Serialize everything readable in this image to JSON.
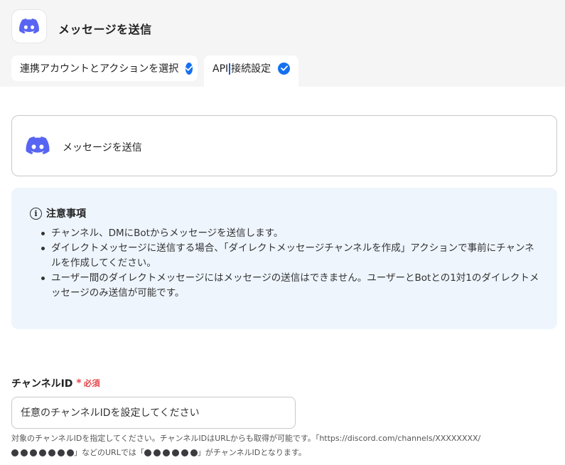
{
  "header": {
    "title": "メッセージを送信",
    "app_icon": "discord-icon"
  },
  "tabs": [
    {
      "label": "連携アカウントとアクションを選択",
      "completed": true
    },
    {
      "label_before_cursor": "API",
      "label_after_cursor": "接続設定",
      "completed": true,
      "active": true
    }
  ],
  "action_card": {
    "title": "メッセージを送信",
    "icon": "discord-icon"
  },
  "notice": {
    "title": "注意事項",
    "items": [
      "チャンネル、DMにBotからメッセージを送信します。",
      "ダイレクトメッセージに送信する場合、「ダイレクトメッセージチャンネルを作成」アクションで事前にチャンネルを作成してください。",
      "ユーザー間のダイレクトメッセージにはメッセージの送信はできません。ユーザーとBotとの1対1のダイレクトメッセージのみ送信が可能です。"
    ]
  },
  "channel_field": {
    "label": "チャンネルID",
    "required_mark": "*",
    "required_text": "必須",
    "placeholder": "任意のチャンネルIDを設定してください",
    "help_line1": "対象のチャンネルIDを指定してください。チャンネルIDはURLからも取得が可能です。「https://discord.com/channels/XXXXXXXX/",
    "help_line2_a": "」などのURLでは「",
    "help_line2_b": "」がチャンネルIDとなります。"
  },
  "colors": {
    "accent": "#1570ef",
    "discord": "#5865f2",
    "required": "#e5484d",
    "notice_bg": "#eef5fd"
  }
}
